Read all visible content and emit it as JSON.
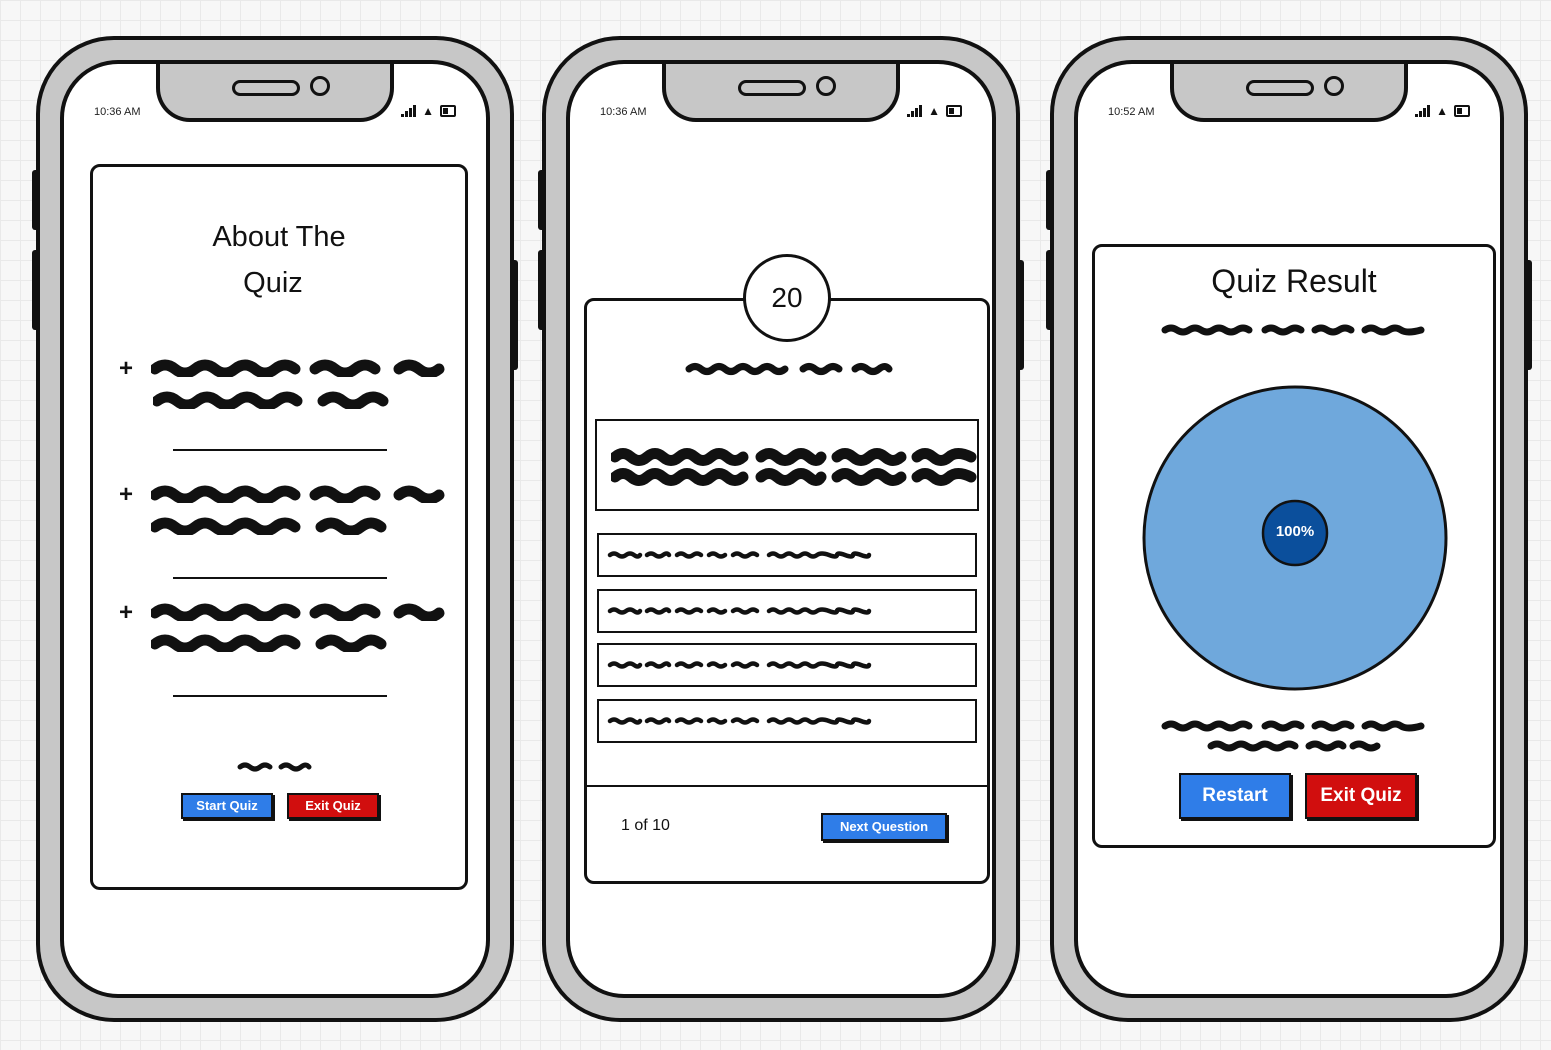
{
  "phones": [
    {
      "status_time": "10:36 AM",
      "screen": "about",
      "title_line1": "About The",
      "title_line2": "Quiz",
      "bullets": [
        "+",
        "+",
        "+"
      ],
      "start_button": "Start Quiz",
      "exit_button": "Exit Quiz"
    },
    {
      "status_time": "10:36 AM",
      "screen": "question",
      "timer": "20",
      "progress": "1 of 10",
      "next_button": "Next Question"
    },
    {
      "status_time": "10:52 AM",
      "screen": "result",
      "title": "Quiz Result",
      "score_label": "100%",
      "score_value": 100,
      "restart_button": "Restart",
      "exit_button": "Exit Quiz"
    }
  ],
  "colors": {
    "blue_button": "#2f7de8",
    "red_button": "#d10e0e",
    "pie_fill": "#6fa8dc",
    "pie_center": "#0b4f9c"
  },
  "icons": [
    "signal-icon",
    "wifi-icon",
    "battery-icon"
  ]
}
